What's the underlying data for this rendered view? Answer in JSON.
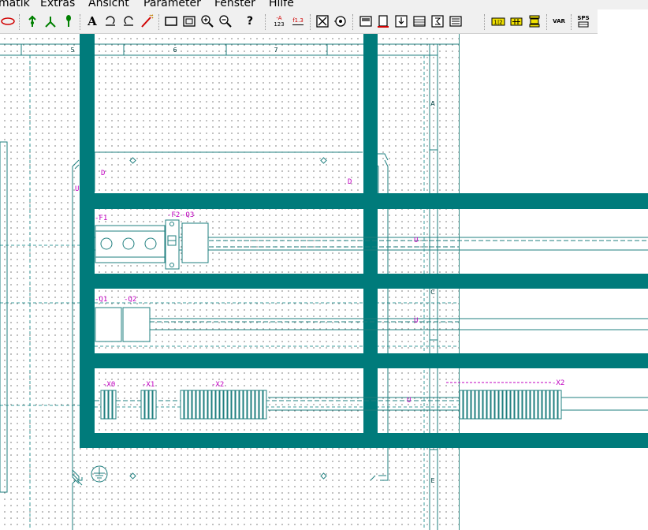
{
  "menu": [
    "matik",
    "Extras",
    "Ansicht",
    "Parameter",
    "Fenster",
    "Hilfe"
  ],
  "toolbar": {
    "text_tool": "A",
    "help": "?",
    "minus_a": "-A",
    "num_123": "123",
    "f13": "f1.3",
    "var": "VAR",
    "sps": "SPS"
  },
  "drawing": {
    "columns": [
      "5",
      "6",
      "7"
    ],
    "rows": [
      "A",
      "C",
      "E"
    ],
    "devices": {
      "f1": "-F1",
      "f2": "-F2",
      "q3": "-Q3",
      "q1": "-Q1",
      "q2": "-Q2",
      "x0": "-X0",
      "x1": "-X1",
      "x2": "-X2",
      "x2_right": "-X2"
    },
    "markers": {
      "u": "U",
      "d": "D"
    }
  },
  "colors": {
    "teal": "#007b7b",
    "line": "#1f7f7f",
    "dash": "#3c9c9c",
    "magenta": "#c000c0",
    "toolbar_bg": "#f0f0f0"
  }
}
